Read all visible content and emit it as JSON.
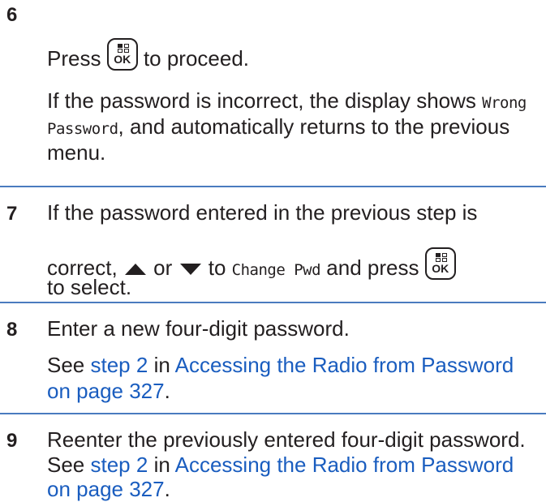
{
  "steps": [
    {
      "number": "6",
      "lines": {
        "press": "Press",
        "proceed": "to proceed.",
        "p2a": "If the password is incorrect, the display shows",
        "wrong1": "Wrong",
        "wrong2": "Password",
        "p2b": ", and automatically returns to the previous",
        "p2c": "menu."
      }
    },
    {
      "number": "7",
      "lines": {
        "l1": "If the password entered in the previous step is",
        "correct": "correct,",
        "or": "or",
        "to": "to",
        "changepwd": "Change Pwd",
        "andpress": "and press",
        "l3": "to select."
      }
    },
    {
      "number": "8",
      "lines": {
        "l1": "Enter a new four-digit password.",
        "see": "See",
        "steplink": "step 2",
        "in": "in",
        "link": "Accessing the Radio from Password",
        "pagelink": "on page 327",
        "dot": "."
      }
    },
    {
      "number": "9",
      "lines": {
        "l1": "Reenter the previously entered four-digit password.",
        "see": "See",
        "steplink": "step 2",
        "in": "in",
        "link": "Accessing the Radio from Password",
        "pagelink": "on page 327",
        "dot": "."
      }
    }
  ],
  "icons": {
    "ok_button": "ok-menu-button-icon",
    "up": "up-arrow-icon",
    "down": "down-arrow-icon"
  },
  "ok_label": "OK",
  "colors": {
    "link": "#1a5dbf",
    "rule": "#4a7bbf",
    "text": "#231f20"
  }
}
